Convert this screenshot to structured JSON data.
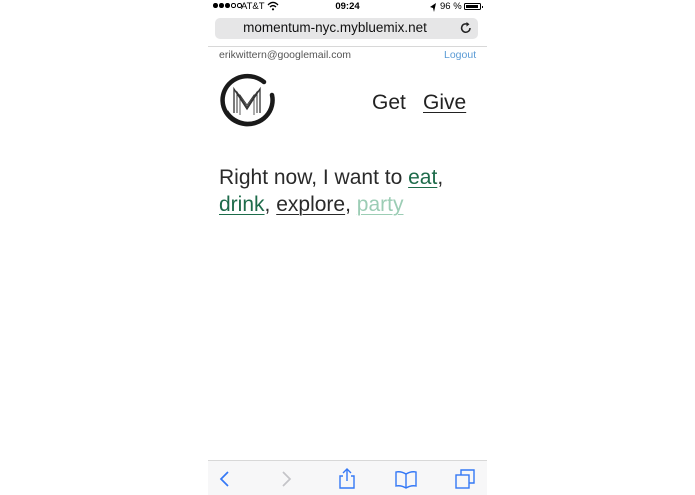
{
  "status_bar": {
    "carrier": "AT&T",
    "time": "09:24",
    "battery": "96 %"
  },
  "browser": {
    "url": "momentum-nyc.mybluemix.net"
  },
  "page": {
    "user_email": "erikwittern@googlemail.com",
    "logout_label": "Logout",
    "nav": {
      "get_label": "Get",
      "give_label": "Give"
    },
    "headline_prefix": "Right now, I want to",
    "options": {
      "eat": "eat",
      "drink": "drink",
      "explore": "explore",
      "party": "party"
    },
    "separator": ",",
    "colors": {
      "accent_dark_green": "#1d6b4a",
      "accent_light_green": "#9ccdb5",
      "link_blue": "#5b9bd5"
    }
  },
  "toolbar": {
    "icons": [
      "back-icon",
      "forward-icon",
      "share-icon",
      "bookmarks-icon",
      "tabs-icon"
    ]
  }
}
